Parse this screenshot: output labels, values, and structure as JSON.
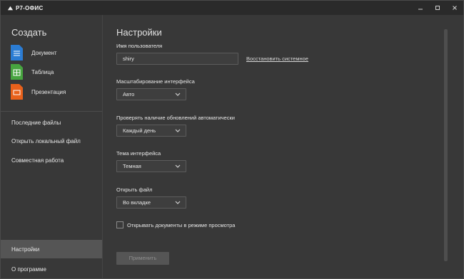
{
  "app": {
    "logo_text": "Р7-ОФИС"
  },
  "sidebar": {
    "create_title": "Создать",
    "create_items": [
      {
        "label": "Документ",
        "color": "#2b7cd3",
        "icon": "document-icon"
      },
      {
        "label": "Таблица",
        "color": "#47a43f",
        "icon": "spreadsheet-icon"
      },
      {
        "label": "Презентация",
        "color": "#e8611b",
        "icon": "presentation-icon"
      }
    ],
    "nav": [
      {
        "label": "Последние файлы"
      },
      {
        "label": "Открыть локальный файл"
      },
      {
        "label": "Совместная работа"
      }
    ],
    "bottom_nav": [
      {
        "label": "Настройки",
        "active": true
      },
      {
        "label": "О программе",
        "active": false
      }
    ]
  },
  "settings": {
    "title": "Настройки",
    "username_label": "Имя пользователя",
    "username_value": "shiry",
    "restore_link": "Восстановить системное",
    "scale_label": "Масштабирование интерфейса",
    "scale_value": "Авто",
    "updates_label": "Проверять наличие обновлений автоматически",
    "updates_value": "Каждый день",
    "theme_label": "Тема интерфейса",
    "theme_value": "Темная",
    "open_label": "Открыть файл",
    "open_value": "Во вкладке",
    "readonly_checkbox": "Открывать документы в режиме просмотра",
    "readonly_checked": false,
    "apply_button": "Применить"
  }
}
